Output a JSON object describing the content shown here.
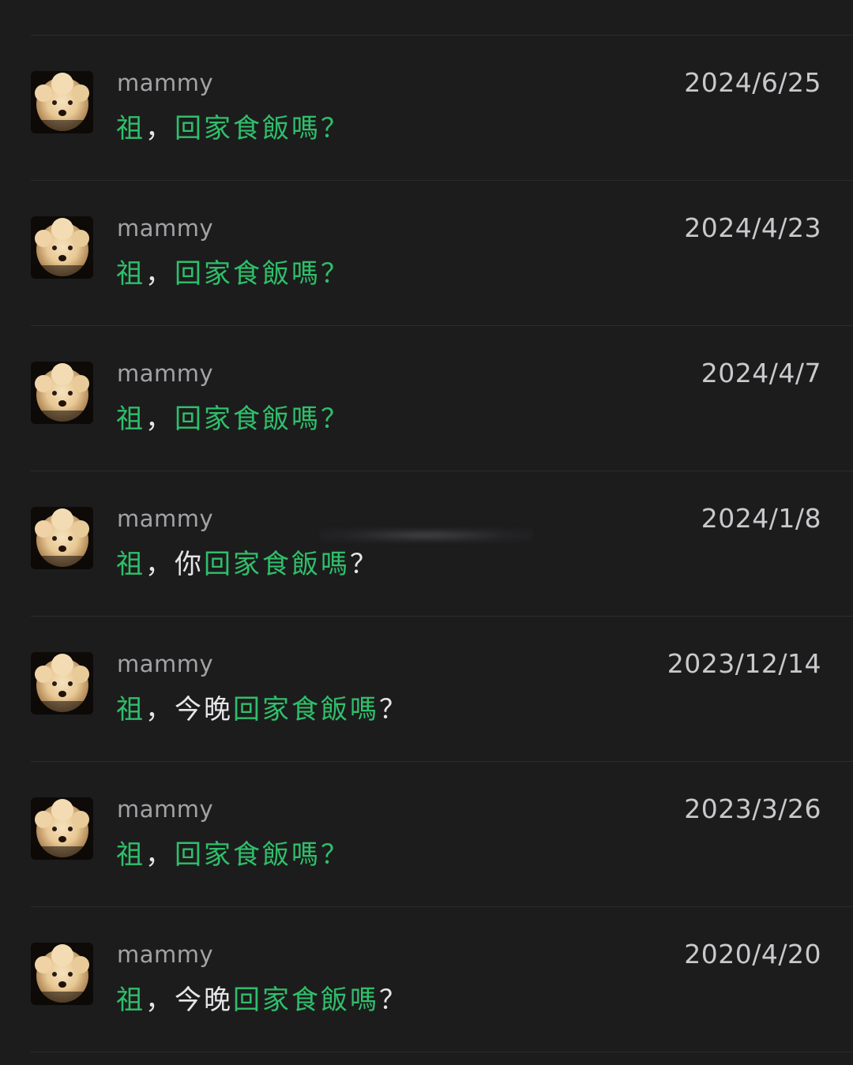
{
  "search_results": [
    {
      "sender": "mammy",
      "date": "2024/6/25",
      "message_segments": [
        {
          "text": "祖",
          "highlight": true
        },
        {
          "text": "，",
          "highlight": false
        },
        {
          "text": "回家食飯嗎",
          "highlight": true
        },
        {
          "text": "？",
          "highlight": true
        }
      ]
    },
    {
      "sender": "mammy",
      "date": "2024/4/23",
      "message_segments": [
        {
          "text": "祖",
          "highlight": true
        },
        {
          "text": "，",
          "highlight": false
        },
        {
          "text": "回家食飯嗎",
          "highlight": true
        },
        {
          "text": "？",
          "highlight": true
        }
      ]
    },
    {
      "sender": "mammy",
      "date": "2024/4/7",
      "message_segments": [
        {
          "text": "祖",
          "highlight": true
        },
        {
          "text": "，",
          "highlight": false
        },
        {
          "text": "回家食飯嗎",
          "highlight": true
        },
        {
          "text": "？",
          "highlight": true
        }
      ]
    },
    {
      "sender": "mammy",
      "date": "2024/1/8",
      "message_segments": [
        {
          "text": "祖",
          "highlight": true
        },
        {
          "text": "，你",
          "highlight": false
        },
        {
          "text": "回家食飯嗎",
          "highlight": true
        },
        {
          "text": "？",
          "highlight": false
        }
      ]
    },
    {
      "sender": "mammy",
      "date": "2023/12/14",
      "message_segments": [
        {
          "text": "祖",
          "highlight": true
        },
        {
          "text": "，今晚",
          "highlight": false
        },
        {
          "text": "回家食飯嗎",
          "highlight": true
        },
        {
          "text": "？",
          "highlight": false
        }
      ]
    },
    {
      "sender": "mammy",
      "date": "2023/3/26",
      "message_segments": [
        {
          "text": "祖",
          "highlight": true
        },
        {
          "text": "，",
          "highlight": false
        },
        {
          "text": "回家食飯嗎",
          "highlight": true
        },
        {
          "text": "？",
          "highlight": true
        }
      ]
    },
    {
      "sender": "mammy",
      "date": "2020/4/20",
      "message_segments": [
        {
          "text": "祖",
          "highlight": true
        },
        {
          "text": "，今晚",
          "highlight": false
        },
        {
          "text": "回家食飯嗎",
          "highlight": true
        },
        {
          "text": "？",
          "highlight": false
        }
      ]
    }
  ],
  "colors": {
    "background": "#1c1c1d",
    "highlight": "#2fbf6a",
    "plain_text": "#e6e6e8",
    "sender": "#a3a3a6",
    "date": "#c9c9cc",
    "divider": "#2c2c2e"
  },
  "avatar_icon": "poodle-avatar-icon"
}
